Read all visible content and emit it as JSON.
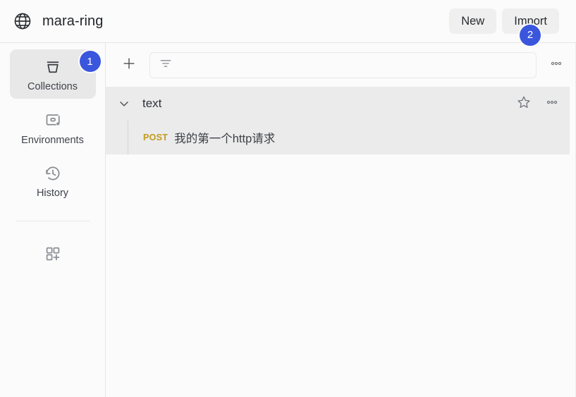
{
  "header": {
    "logo_icon": "globe-icon",
    "title": "mara-ring",
    "new_label": "New",
    "import_label": "Import",
    "import_badge": "2"
  },
  "sidebar": {
    "items": [
      {
        "label": "Collections",
        "icon": "collections-icon",
        "badge": "1",
        "active": true
      },
      {
        "label": "Environments",
        "icon": "environments-icon",
        "badge": "",
        "active": false
      },
      {
        "label": "History",
        "icon": "history-clock-icon",
        "badge": "",
        "active": false
      }
    ],
    "add_module": {
      "icon": "grid-plus-icon",
      "label": ""
    }
  },
  "toolbar": {
    "add_icon": "plus-icon",
    "filter_icon": "filter-icon",
    "filter_placeholder": "",
    "filter_value": "",
    "more_icon": "more-horizontal-icon"
  },
  "collections": [
    {
      "name": "text",
      "expanded": true,
      "chevron_icon": "chevron-down-icon",
      "favorite_icon": "star-icon",
      "more_icon": "more-horizontal-icon",
      "requests": [
        {
          "method": "POST",
          "name": "我的第一个http请求"
        }
      ]
    }
  ],
  "colors": {
    "badge_blue": "#3a56dd",
    "method_post": "#c19a1f",
    "panel_bg": "#fbfbfb",
    "collection_bg": "#ebebeb",
    "button_bg": "#efefef"
  }
}
